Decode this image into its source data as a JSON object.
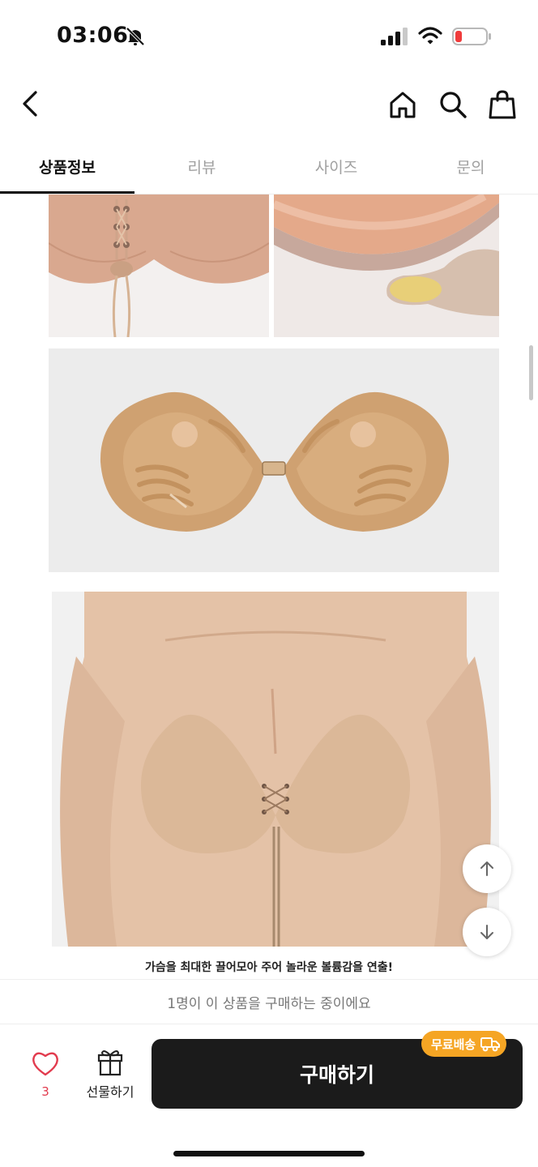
{
  "status_bar": {
    "time": "03:06"
  },
  "tabs": [
    {
      "label": "상품정보",
      "active": true
    },
    {
      "label": "리뷰",
      "active": false
    },
    {
      "label": "사이즈",
      "active": false
    },
    {
      "label": "문의",
      "active": false
    }
  ],
  "content": {
    "caption": "가슴을 최대한 끌어모아 주어 놀라운 볼륨감을 연출!"
  },
  "notice": "1명이 이 상품을 구매하는 중이에요",
  "bottom": {
    "like_count": "3",
    "gift_label": "선물하기",
    "buy_label": "구매하기",
    "shipping_badge": "무료배송"
  },
  "colors": {
    "accent_badge": "#f5a524",
    "buy_button": "#1b1b1b",
    "like": "#e23b4e",
    "product": "#d9a56f"
  }
}
